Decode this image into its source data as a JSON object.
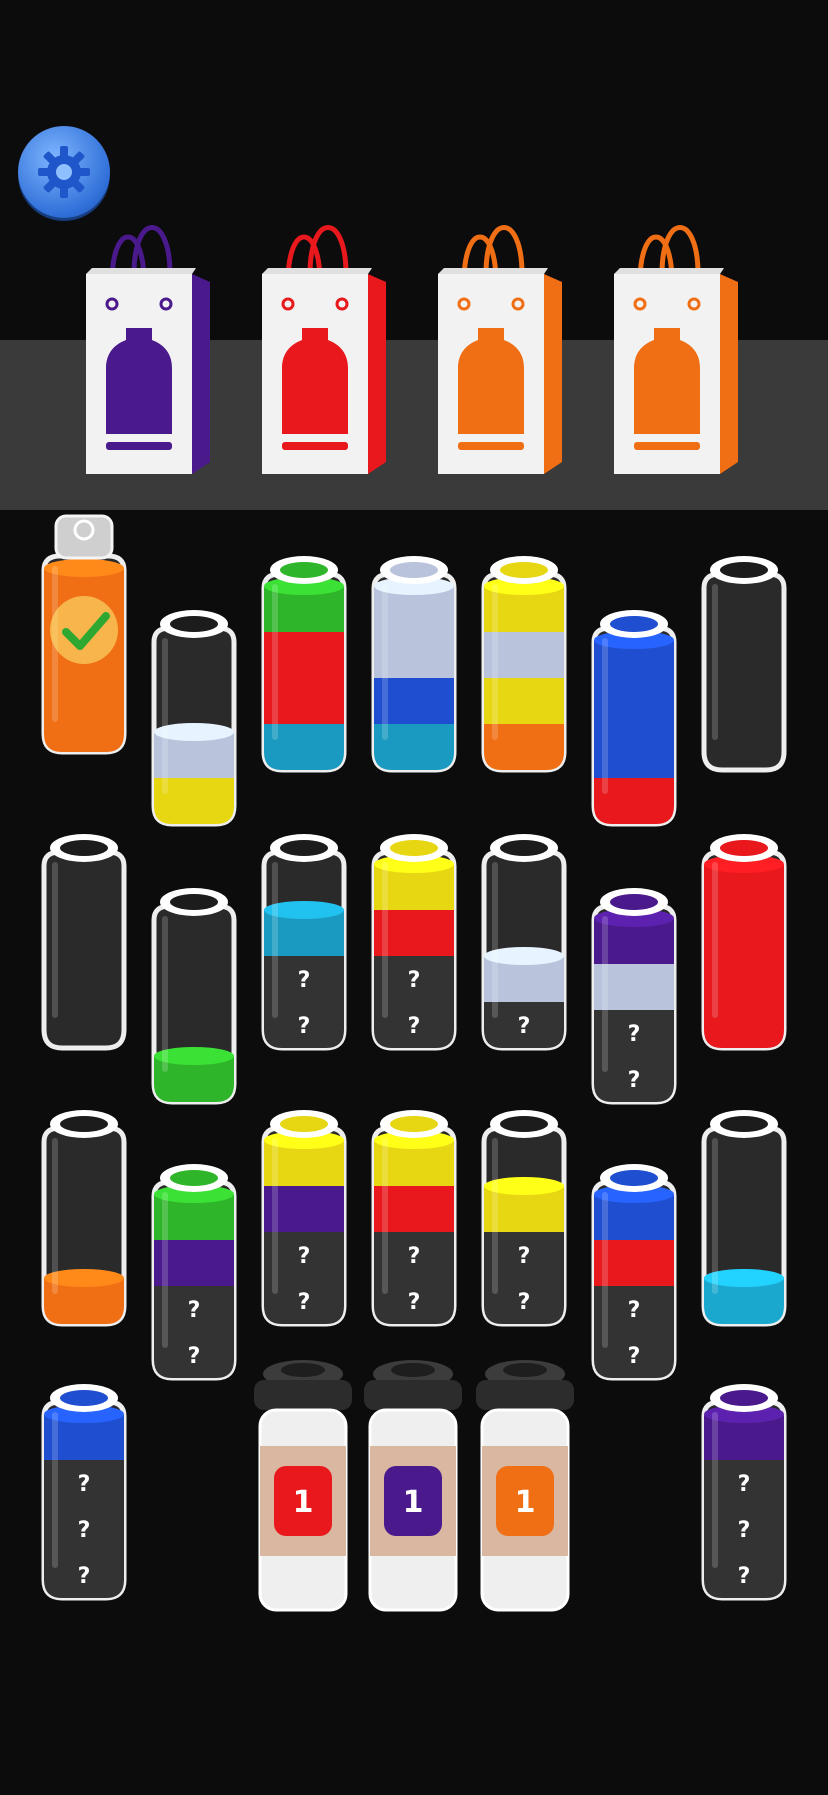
{
  "colors": {
    "purple": "#4a1a8c",
    "red": "#e8181c",
    "orange": "#f06e14",
    "green": "#2fb52a",
    "yellow": "#e7d612",
    "blue": "#1f4fd0",
    "teal": "#1a9ac0",
    "lavender": "#b9c3dc",
    "cyan": "#1ba8cf"
  },
  "settings_button": {
    "icon": "gear-icon"
  },
  "bags": [
    {
      "color": "#4a1a8c"
    },
    {
      "color": "#e8181c"
    },
    {
      "color": "#f06e14"
    },
    {
      "color": "#f06e14"
    }
  ],
  "bottles": [
    {
      "layers": [
        "orange",
        "orange",
        "orange",
        "orange"
      ],
      "hidden": 0,
      "state": "completed"
    },
    {
      "layers": [
        "yellow",
        "lavender"
      ],
      "hidden": 0
    },
    {
      "layers": [
        "teal",
        "red",
        "red",
        "green"
      ],
      "hidden": 0
    },
    {
      "layers": [
        "teal",
        "blue",
        "lavender",
        "lavender"
      ],
      "hidden": 0
    },
    {
      "layers": [
        "orange",
        "yellow",
        "lavender",
        "yellow"
      ],
      "hidden": 0
    },
    {
      "layers": [
        "red",
        "blue",
        "blue",
        "blue"
      ],
      "hidden": 0
    },
    {
      "layers": [],
      "hidden": 0
    },
    {
      "layers": [],
      "hidden": 0
    },
    {
      "layers": [
        "green"
      ],
      "hidden": 0
    },
    {
      "layers": [
        "teal"
      ],
      "hidden": 2
    },
    {
      "layers": [
        "red",
        "yellow"
      ],
      "hidden": 2
    },
    {
      "layers": [
        "lavender"
      ],
      "hidden": 1
    },
    {
      "layers": [
        "lavender",
        "purple"
      ],
      "hidden": 2
    },
    {
      "layers": [
        "red",
        "red",
        "red",
        "red"
      ],
      "hidden": 0
    },
    {
      "layers": [
        "orange"
      ],
      "hidden": 0
    },
    {
      "layers": [
        "purple",
        "green"
      ],
      "hidden": 2
    },
    {
      "layers": [
        "purple",
        "yellow"
      ],
      "hidden": 2
    },
    {
      "layers": [
        "red",
        "yellow"
      ],
      "hidden": 2
    },
    {
      "layers": [
        "yellow"
      ],
      "hidden": 2
    },
    {
      "layers": [
        "red",
        "blue"
      ],
      "hidden": 2
    },
    {
      "layers": [
        "cyan"
      ],
      "hidden": 0
    },
    {
      "layers": [
        "blue"
      ],
      "hidden": 3
    },
    {
      "layers": [
        "purple"
      ],
      "hidden": 3
    }
  ],
  "hidden_marker": "?",
  "cups": [
    {
      "label": "1",
      "color": "#e8181c"
    },
    {
      "label": "1",
      "color": "#4a1a8c"
    },
    {
      "label": "1",
      "color": "#f06e14"
    }
  ]
}
